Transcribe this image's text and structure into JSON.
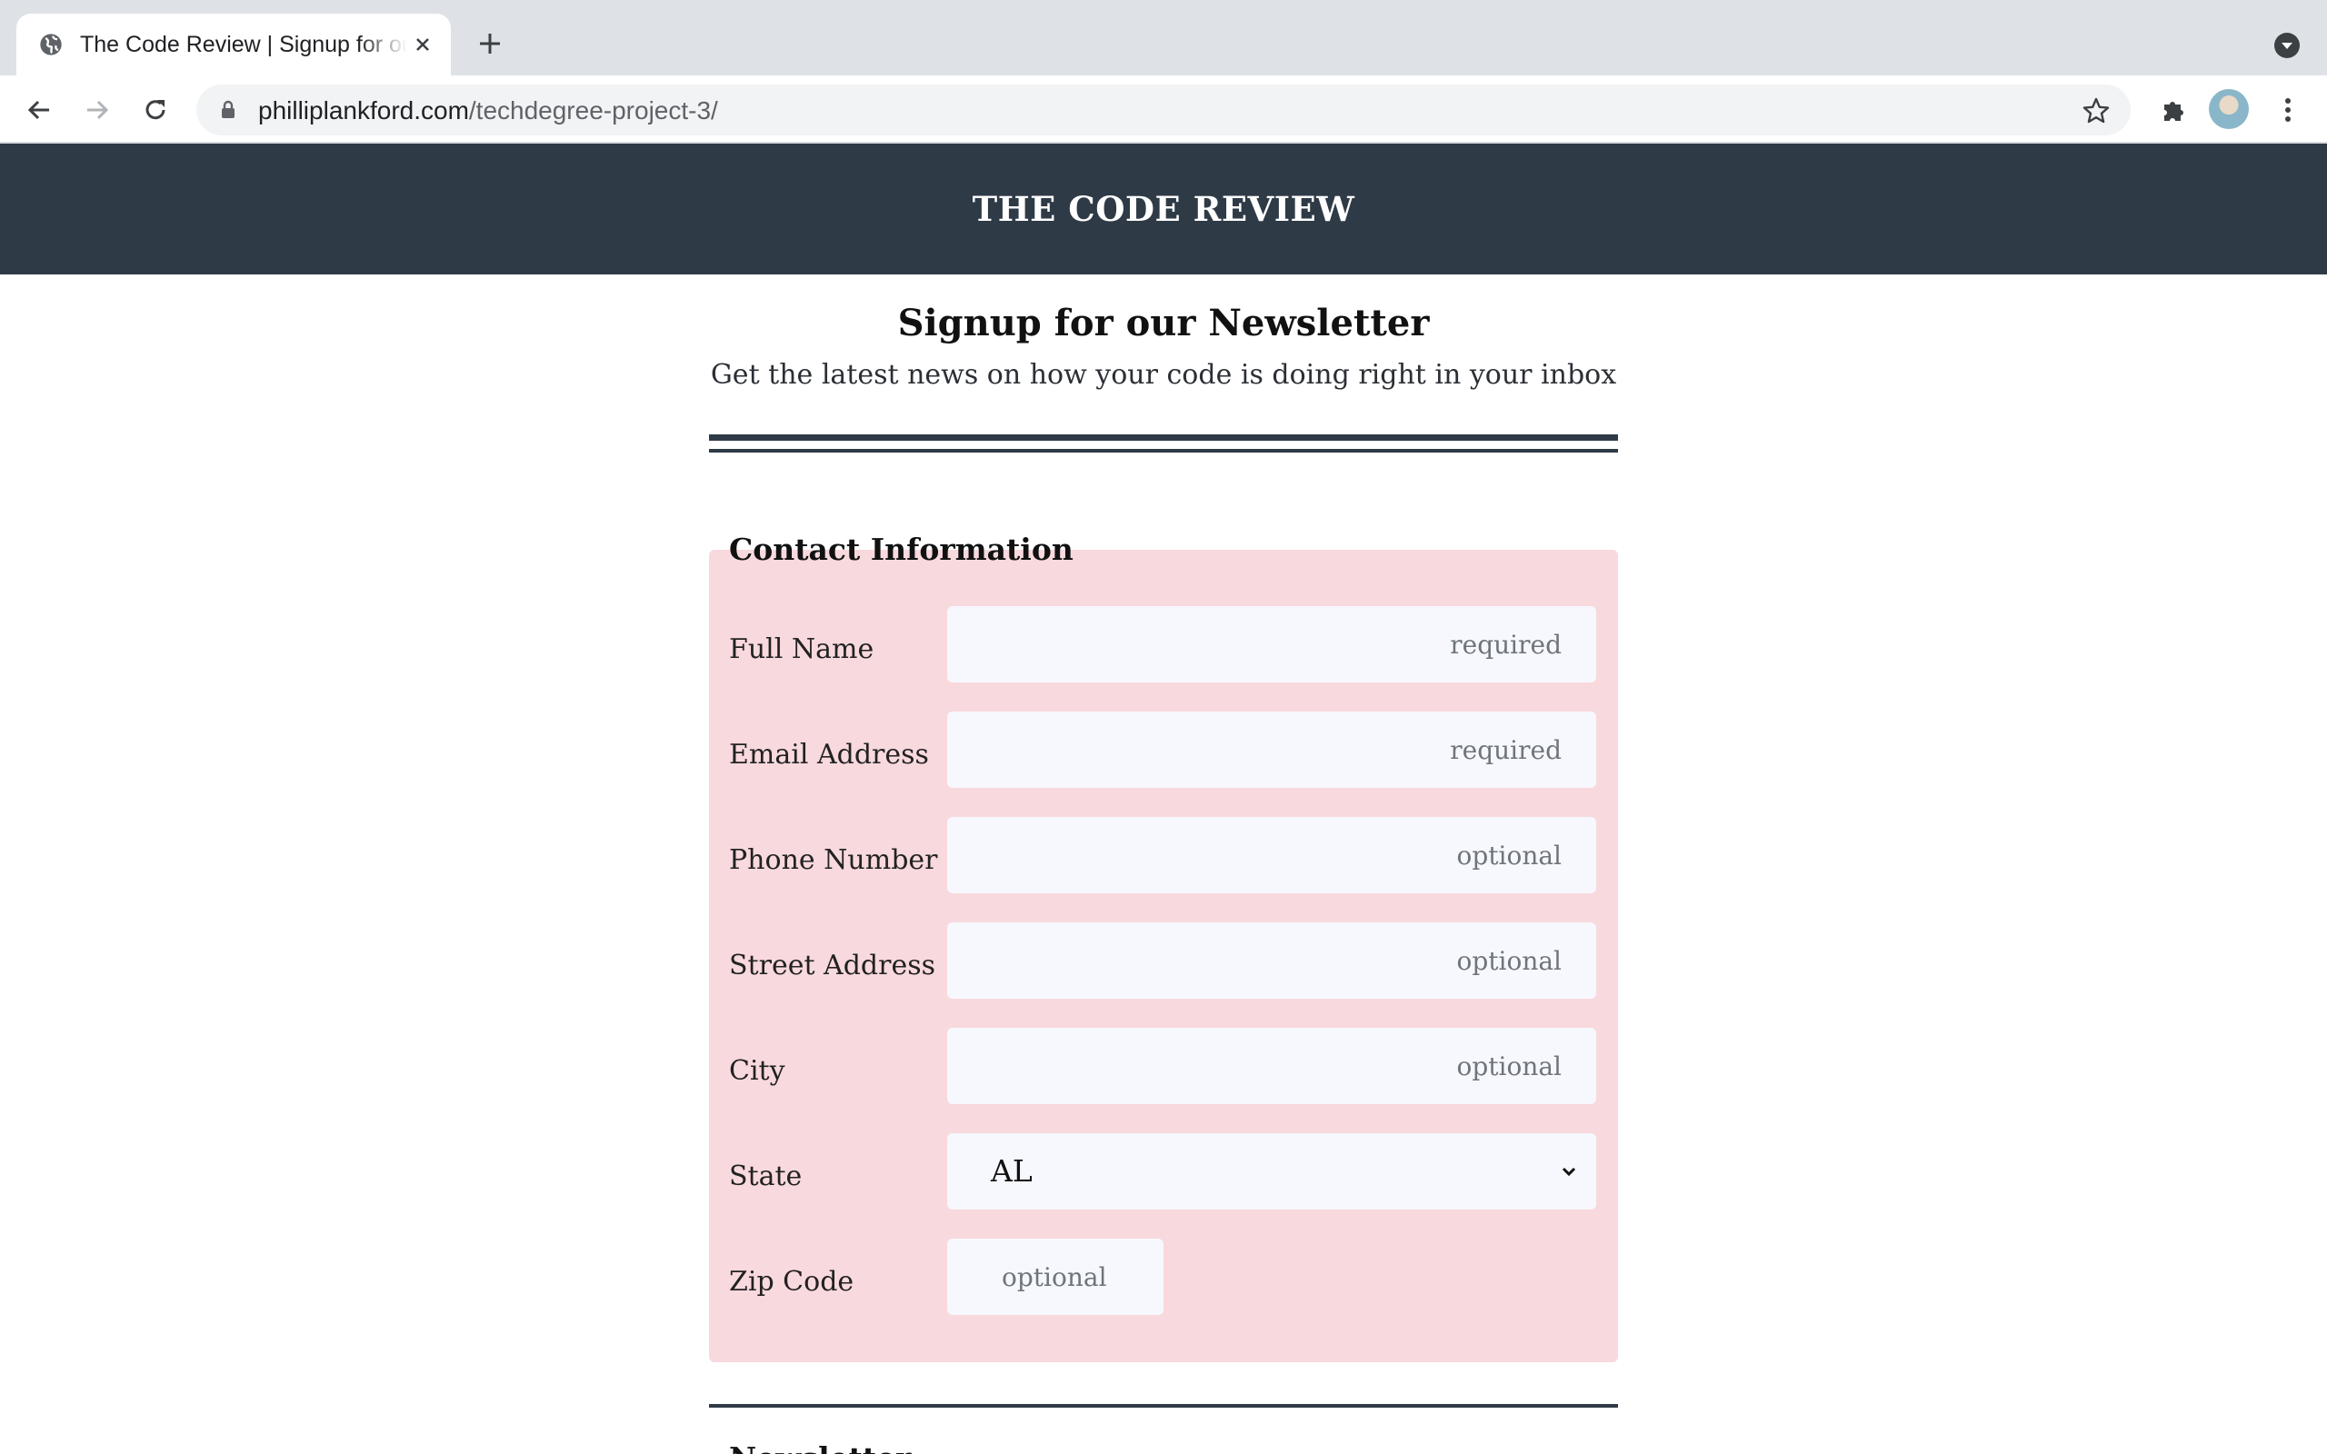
{
  "browser": {
    "tab_title": "The Code Review | Signup for our Newsletter",
    "url_domain": "philliplankford.com",
    "url_path": "/techdegree-project-3/"
  },
  "site": {
    "title": "THE CODE REVIEW"
  },
  "intro": {
    "heading": "Signup for our Newsletter",
    "subheading": "Get the latest news on how your code is doing right in your inbox"
  },
  "contact": {
    "legend": "Contact Information",
    "fields": [
      {
        "label": "Full Name",
        "placeholder": "required"
      },
      {
        "label": "Email Address",
        "placeholder": "required"
      },
      {
        "label": "Phone Number",
        "placeholder": "optional"
      },
      {
        "label": "Street Address",
        "placeholder": "optional"
      },
      {
        "label": "City",
        "placeholder": "optional"
      }
    ],
    "state": {
      "label": "State",
      "value": "AL"
    },
    "zip": {
      "label": "Zip Code",
      "placeholder": "optional"
    }
  },
  "next_section": {
    "legend": "Newsletter"
  },
  "colors": {
    "header_bg": "#2f3a47",
    "fieldset_bg": "#f8d9de",
    "input_bg": "#f7f8fd"
  }
}
